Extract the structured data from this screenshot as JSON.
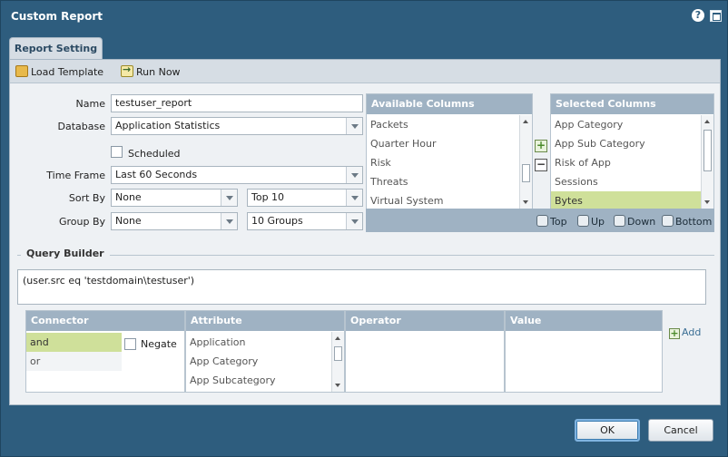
{
  "window": {
    "title": "Custom Report"
  },
  "tabs": [
    {
      "label": "Report Setting"
    }
  ],
  "toolbar": {
    "load_template": "Load Template",
    "run_now": "Run Now"
  },
  "form": {
    "name_label": "Name",
    "name_value": "testuser_report",
    "database_label": "Database",
    "database_value": "Application Statistics",
    "scheduled_label": "Scheduled",
    "time_frame_label": "Time Frame",
    "time_frame_value": "Last 60 Seconds",
    "sort_by_label": "Sort By",
    "sort_by_value": "None",
    "sort_top_value": "Top 10",
    "group_by_label": "Group By",
    "group_by_value": "None",
    "group_count_value": "10 Groups"
  },
  "available_columns": {
    "header": "Available Columns",
    "items": [
      "Packets",
      "Quarter Hour",
      "Risk",
      "Threats",
      "Virtual System"
    ]
  },
  "selected_columns": {
    "header": "Selected Columns",
    "items": [
      "App Category",
      "App Sub Category",
      "Risk of App",
      "Sessions",
      "Bytes"
    ],
    "selected": "Bytes"
  },
  "order": {
    "top": "Top",
    "up": "Up",
    "down": "Down",
    "bottom": "Bottom"
  },
  "query_builder": {
    "title": "Query Builder",
    "query": "(user.src eq 'testdomain\\testuser')",
    "connector_header": "Connector",
    "connectors": [
      "and",
      "or"
    ],
    "negate_label": "Negate",
    "attribute_header": "Attribute",
    "attributes": [
      "Application",
      "App Category",
      "App Subcategory"
    ],
    "operator_header": "Operator",
    "value_header": "Value",
    "add_label": "Add"
  },
  "buttons": {
    "ok": "OK",
    "cancel": "Cancel"
  }
}
